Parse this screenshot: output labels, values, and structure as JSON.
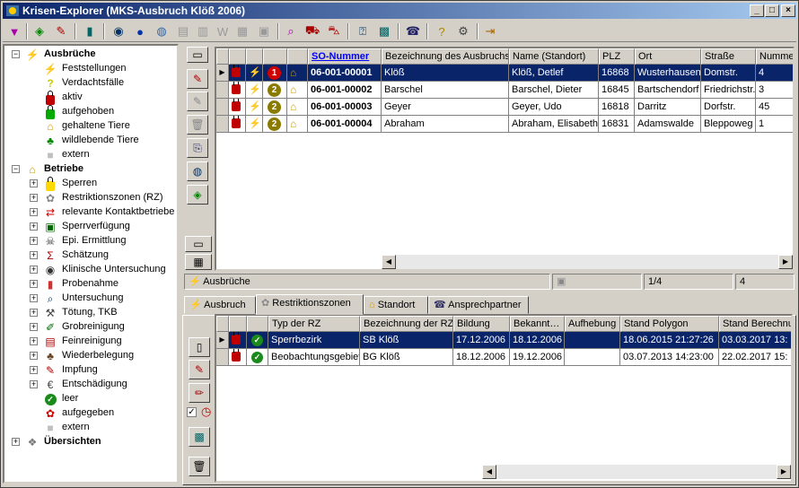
{
  "window": {
    "title": "Krisen-Explorer  (MKS-Ausbruch Klöß 2006)"
  },
  "titlebar_buttons": {
    "minimize": "_",
    "maximize": "□",
    "close": "×"
  },
  "tree": {
    "ausbrueche": {
      "label": "Ausbrüche",
      "expander": "−"
    },
    "ausbrueche_items": [
      "Feststellungen",
      "Verdachtsfälle",
      "aktiv",
      "aufgehoben",
      "gehaltene Tiere",
      "wildlebende Tiere",
      "extern"
    ],
    "betriebe": {
      "label": "Betriebe",
      "expander": "−"
    },
    "betriebe_items": [
      "Sperren",
      "Restriktionszonen (RZ)",
      "relevante Kontaktbetriebe",
      "Sperrverfügung",
      "Epi. Ermittlung",
      "Schätzung",
      "Klinische Untersuchung",
      "Probenahme",
      "Untersuchung",
      "Tötung, TKB",
      "Grobreinigung",
      "Feinreinigung",
      "Wiederbelegung",
      "Impfung",
      "Entschädigung",
      "leer",
      "aufgegeben",
      "extern"
    ],
    "uebersichten": {
      "label": "Übersichten",
      "expander": "+"
    },
    "plus": "+"
  },
  "top_grid": {
    "columns": [
      "SO-Nummer",
      "Bezeichnung des Ausbruchs",
      "Name (Standort)",
      "PLZ",
      "Ort",
      "Straße",
      "Nummer"
    ],
    "rows": [
      {
        "badge": "1",
        "so": "06-001-00001",
        "bez": "Klöß",
        "name": "Klöß, Detlef",
        "plz": "16868",
        "ort": "Wusterhausen",
        "strasse": "Domstr.",
        "nummer": "4"
      },
      {
        "badge": "2",
        "so": "06-001-00002",
        "bez": "Barschel",
        "name": "Barschel, Dieter",
        "plz": "16845",
        "ort": "Bartschendorf",
        "strasse": "Friedrichstr.",
        "nummer": "3"
      },
      {
        "badge": "2",
        "so": "06-001-00003",
        "bez": "Geyer",
        "name": "Geyer, Udo",
        "plz": "16818",
        "ort": "Darritz",
        "strasse": "Dorfstr.",
        "nummer": "45"
      },
      {
        "badge": "2",
        "so": "06-001-00004",
        "bez": "Abraham",
        "name": "Abraham, Elisabeth",
        "plz": "16831",
        "ort": "Adamswalde",
        "strasse": "Bleppoweg",
        "nummer": "1"
      }
    ],
    "row_indicator": "▶"
  },
  "status": {
    "section": "Ausbrüche",
    "position": "1/4",
    "count": "4"
  },
  "tabs": [
    "Ausbruch",
    "Restriktionszonen",
    "Standort",
    "Ansprechpartner"
  ],
  "bottom_grid": {
    "columns": [
      "Typ der RZ",
      "Bezeichnung der RZ",
      "Bildung",
      "Bekannt…",
      "Aufhebung",
      "Stand Polygon",
      "Stand Berechnung"
    ],
    "rows": [
      {
        "typ": "Sperrbezirk",
        "bez": "SB Klöß",
        "bildung": "17.12.2006",
        "bekannt": "18.12.2006",
        "aufhebung": "",
        "polygon": "18.06.2015  21:27:26",
        "berechnung": "03.03.2017  13:"
      },
      {
        "typ": "Beobachtungsgebiet",
        "bez": "BG Klöß",
        "bildung": "18.12.2006",
        "bekannt": "19.12.2006",
        "aufhebung": "",
        "polygon": "03.07.2013  14:23:00",
        "berechnung": "22.02.2017  15:"
      }
    ],
    "row_indicator": "▶"
  },
  "checkbox": {
    "mark": "✓"
  },
  "scroll": {
    "left": "◀",
    "right": "▶"
  }
}
